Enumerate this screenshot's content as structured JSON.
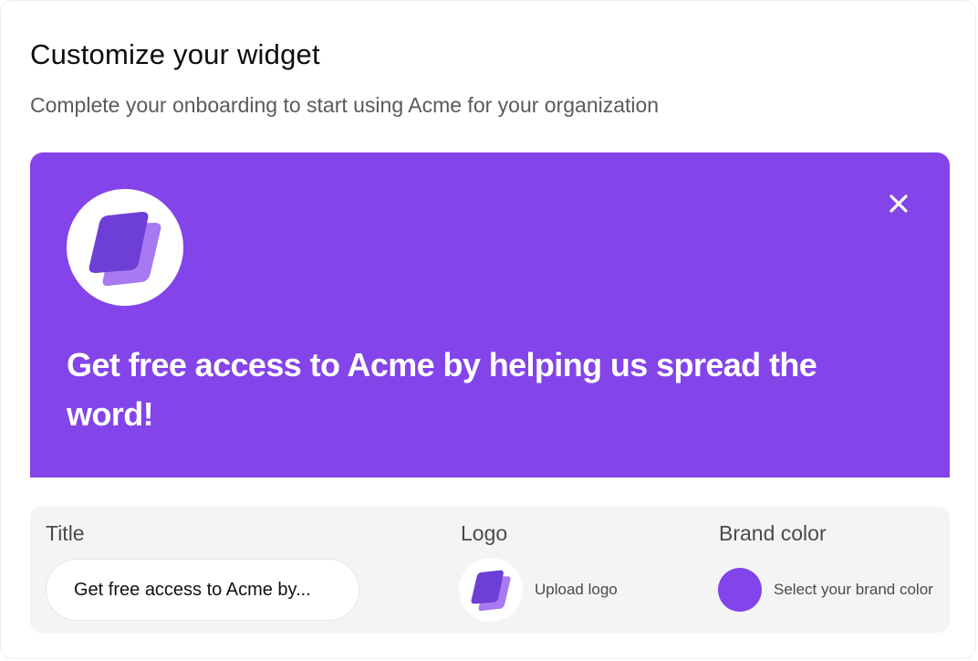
{
  "header": {
    "title": "Customize your widget",
    "subtitle": "Complete your onboarding to start using Acme for your organization"
  },
  "banner": {
    "background_color": "#8344ea",
    "logo_icon": "acme-logo-icon",
    "close_icon": "close-icon",
    "headline": "Get free access to Acme by helping us spread the word!"
  },
  "settings": {
    "title_field": {
      "label": "Title",
      "value": "Get free access to Acme by..."
    },
    "logo_field": {
      "label": "Logo",
      "icon": "acme-logo-icon",
      "upload_label": "Upload logo"
    },
    "brand_color_field": {
      "label": "Brand color",
      "selected_color": "#8344ea",
      "select_label": "Select your brand color"
    }
  },
  "colors": {
    "accent": "#8344ea",
    "logo_dark": "#6d3fd6",
    "logo_light": "#a77af1"
  }
}
